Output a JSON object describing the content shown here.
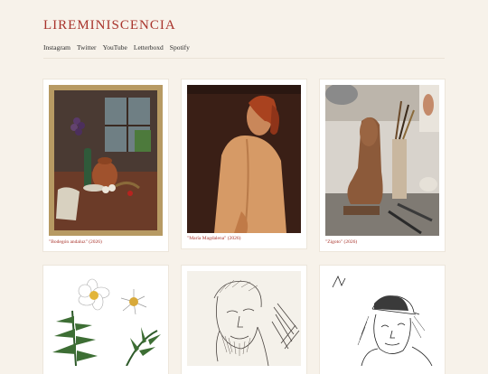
{
  "site": {
    "title": "LIREMINISCENCIA"
  },
  "nav": [
    {
      "label": "Instagram"
    },
    {
      "label": "Twitter"
    },
    {
      "label": "YouTube"
    },
    {
      "label": "Letterboxd"
    },
    {
      "label": "Spotify"
    }
  ],
  "gallery": [
    {
      "caption": "\"Bodegón andaluz\" (2026)",
      "icon": "still-life-painting"
    },
    {
      "caption": "\"María Magdalena\" (2026)",
      "icon": "nude-back-painting"
    },
    {
      "caption": "\"Zigoto\" (2026)",
      "icon": "clay-sculpture-photo"
    },
    {
      "caption": "",
      "icon": "botanical-drawing"
    },
    {
      "caption": "",
      "icon": "man-portrait-sketch"
    },
    {
      "caption": "",
      "icon": "cap-portrait-sketch"
    }
  ],
  "colors": {
    "accent": "#a8332b",
    "background": "#f7f2ea"
  }
}
